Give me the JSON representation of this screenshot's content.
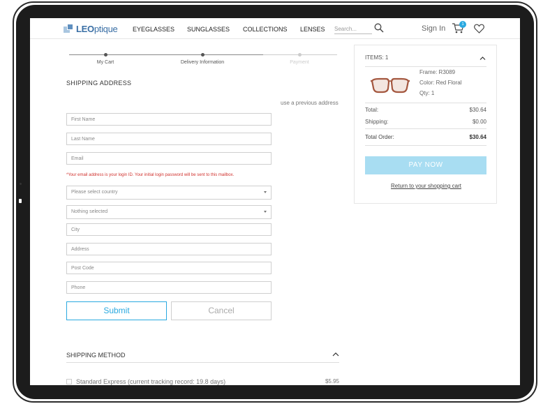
{
  "header": {
    "logo_prefix": "LEO",
    "logo_suffix": "ptique",
    "nav": [
      "EYEGLASSES",
      "SUNGLASSES",
      "COLLECTIONS",
      "LENSES"
    ],
    "search_placeholder": "Search...",
    "sign_in": "Sign In",
    "cart_count": "1"
  },
  "progress": {
    "steps": [
      "My Cart",
      "Delivery Information",
      "Payment"
    ]
  },
  "shipping_address": {
    "title": "SHIPPING ADDRESS",
    "prev_address_link": "use a previous address",
    "first_name_placeholder": "First Name",
    "last_name_placeholder": "Last Name",
    "email_placeholder": "Email",
    "email_hint": "*Your email address is your login ID. Your initial login password will be sent to this mailbox.",
    "country_select": "Please select country",
    "state_select": "Nothing selected",
    "city_placeholder": "City",
    "address_placeholder": "Address",
    "postcode_placeholder": "Post Code",
    "phone_placeholder": "Phone",
    "submit_label": "Submit",
    "cancel_label": "Cancel"
  },
  "shipping_method": {
    "title": "SHIPPING METHOD",
    "option_label": "Standard Express (current tracking record: 19.8 days)",
    "option_price": "$5.95"
  },
  "summary": {
    "items_label": "ITEMS: 1",
    "frame": "Frame: R3089",
    "color": "Color: Red Floral",
    "qty": "Qty: 1",
    "total_label": "Total:",
    "total_value": "$30.64",
    "shipping_label": "Shipping:",
    "shipping_value": "$0.00",
    "order_label": "Total Order:",
    "order_value": "$30.64",
    "pay_label": "PAY NOW",
    "return_link": "Return to your shopping cart"
  },
  "colors": {
    "accent": "#2aa9e0",
    "pay_button": "#a8ddf2",
    "error": "#d0312d",
    "logo": "#3a6fa5"
  }
}
